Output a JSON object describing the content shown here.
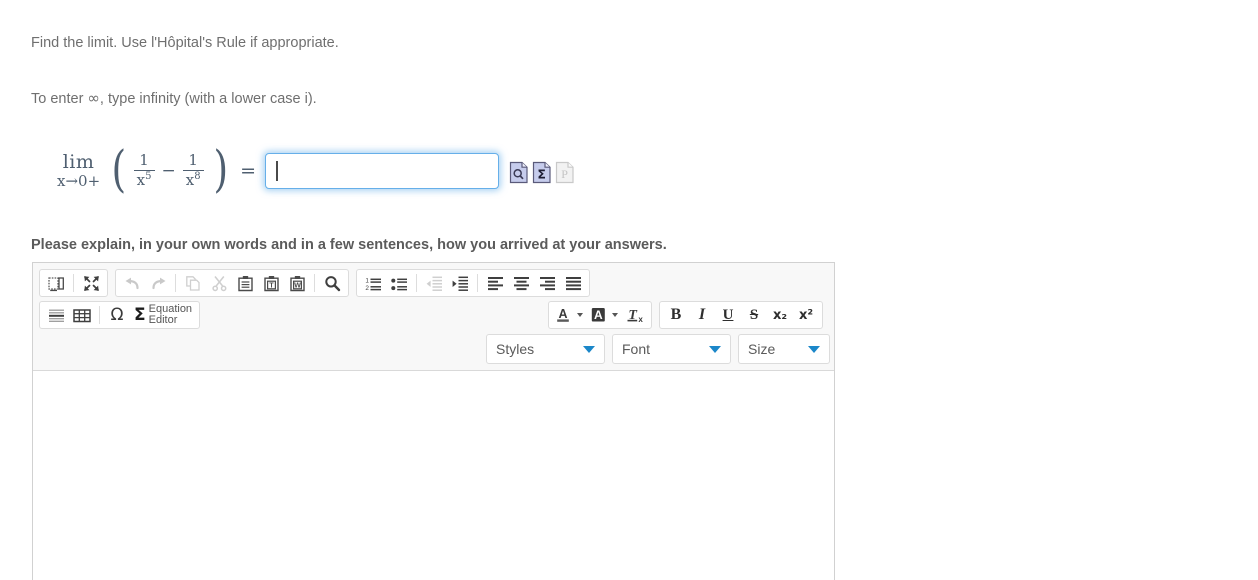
{
  "problem": {
    "instruction_line_1": "Find the limit. Use l'Hôpital's Rule if appropriate.",
    "instruction_line_2_before": "To enter ",
    "infinity_symbol": "∞",
    "instruction_line_2_after": ", type infinity (with a lower case i).",
    "math": {
      "limit_operator": "lim",
      "limit_subscript": "x→0+",
      "open_paren": "(",
      "term1_numerator": "1",
      "term1_denominator_base": "x",
      "term1_denominator_exponent": "5",
      "operator": "−",
      "term2_numerator": "1",
      "term2_denominator_base": "x",
      "term2_denominator_exponent": "8",
      "close_paren": ")",
      "equals": "="
    },
    "answer_input": {
      "value": "",
      "placeholder": "",
      "focused": true
    },
    "tool_icons": [
      {
        "name": "preview-answer-icon",
        "glyph": "magnifier-page",
        "enabled": true
      },
      {
        "name": "math-palette-icon",
        "glyph": "sigma-page",
        "enabled": true
      },
      {
        "name": "practice-page-icon",
        "glyph": "p-page",
        "enabled": false
      }
    ]
  },
  "explain": {
    "label": "Please explain, in your own words and in a few sentences, how you arrived at your answers."
  },
  "editor": {
    "toolbar_row_1": [
      {
        "name": "templates-button",
        "icon": "templates-icon",
        "enabled": true
      },
      {
        "name": "maximize-button",
        "icon": "maximize-icon",
        "enabled": true
      },
      {
        "name": "undo-button",
        "icon": "undo-icon",
        "enabled": false
      },
      {
        "name": "redo-button",
        "icon": "redo-icon",
        "enabled": false
      },
      {
        "name": "copy-button",
        "icon": "copy-icon",
        "enabled": false
      },
      {
        "name": "cut-button",
        "icon": "cut-icon",
        "enabled": false
      },
      {
        "name": "paste-button",
        "icon": "paste-icon",
        "enabled": true
      },
      {
        "name": "paste-as-text-button",
        "icon": "paste-text-icon",
        "enabled": true
      },
      {
        "name": "paste-from-word-button",
        "icon": "paste-word-icon",
        "enabled": true
      },
      {
        "name": "find-button",
        "icon": "search-icon",
        "enabled": true
      },
      {
        "name": "numbered-list-button",
        "icon": "numbered-list-icon",
        "enabled": true
      },
      {
        "name": "bulleted-list-button",
        "icon": "bulleted-list-icon",
        "enabled": true
      },
      {
        "name": "outdent-button",
        "icon": "outdent-icon",
        "enabled": false
      },
      {
        "name": "indent-button",
        "icon": "indent-icon",
        "enabled": true
      },
      {
        "name": "align-left-button",
        "icon": "align-left-icon",
        "enabled": true
      },
      {
        "name": "align-center-button",
        "icon": "align-center-icon",
        "enabled": true
      },
      {
        "name": "align-right-button",
        "icon": "align-right-icon",
        "enabled": true
      },
      {
        "name": "align-justify-button",
        "icon": "align-justify-icon",
        "enabled": true
      }
    ],
    "toolbar_row_2_left": [
      {
        "name": "horizontal-rule-button",
        "icon": "horizontal-rule-icon",
        "enabled": true
      },
      {
        "name": "insert-table-button",
        "icon": "table-icon",
        "enabled": true
      },
      {
        "name": "special-character-button",
        "icon": "omega-icon",
        "glyph": "Ω",
        "enabled": true
      },
      {
        "name": "equation-editor-button",
        "icon": "sigma-icon",
        "glyph": "Σ",
        "label": "Equation\nEditor",
        "enabled": true
      }
    ],
    "toolbar_row_2_right": [
      {
        "name": "text-color-button",
        "icon": "text-color-icon",
        "glyph": "A",
        "enabled": true
      },
      {
        "name": "background-color-button",
        "icon": "background-color-icon",
        "glyph": "A",
        "enabled": true
      },
      {
        "name": "remove-format-button",
        "icon": "remove-format-icon",
        "glyph": "Tx",
        "enabled": true
      },
      {
        "name": "bold-button",
        "icon": "bold-icon",
        "glyph": "B",
        "enabled": true
      },
      {
        "name": "italic-button",
        "icon": "italic-icon",
        "glyph": "I",
        "enabled": true
      },
      {
        "name": "underline-button",
        "icon": "underline-icon",
        "glyph": "U",
        "enabled": true
      },
      {
        "name": "strikethrough-button",
        "icon": "strikethrough-icon",
        "glyph": "S",
        "enabled": true
      },
      {
        "name": "subscript-button",
        "icon": "subscript-icon",
        "glyph": "x₂",
        "enabled": true
      },
      {
        "name": "superscript-button",
        "icon": "superscript-icon",
        "glyph": "x²",
        "enabled": true
      }
    ],
    "dropdowns": {
      "styles": {
        "label": "Styles",
        "selected": "Styles"
      },
      "font": {
        "label": "Font",
        "selected": "Font"
      },
      "size": {
        "label": "Size",
        "selected": "Size"
      }
    },
    "body_content": ""
  },
  "colors": {
    "text": "#6f6f6f",
    "label_bold": "#5b5b5b",
    "math": "#4f5f70",
    "input_focus_border": "#66afe9",
    "toolbar_background": "#f8f8f8",
    "toolbar_border": "#d1d1d1",
    "dropdown_arrow": "#1b87c9",
    "icon_enabled": "#4a4a4a",
    "icon_disabled": "#c6c6c6",
    "doc_icon_fill": "#c6ccec"
  }
}
